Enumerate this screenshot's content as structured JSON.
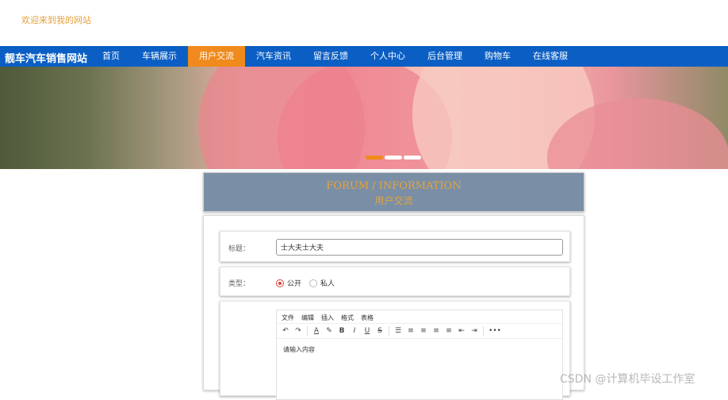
{
  "header": {
    "welcome": "欢迎来到我的网站"
  },
  "nav": {
    "brand": "靓车汽车销售网站",
    "items": [
      {
        "label": "首页"
      },
      {
        "label": "车辆展示"
      },
      {
        "label": "用户交流",
        "active": true
      },
      {
        "label": "汽车资讯"
      },
      {
        "label": "留言反馈"
      },
      {
        "label": "个人中心"
      },
      {
        "label": "后台管理"
      },
      {
        "label": "购物车"
      },
      {
        "label": "在线客服"
      }
    ]
  },
  "banner": {
    "slides": 3,
    "active_slide": 1
  },
  "section": {
    "title_en": "FORUM / INFORMATION",
    "title_cn": "用户交流"
  },
  "form": {
    "title_label": "标题：",
    "title_value": "士大夫士大夫",
    "type_label": "类型：",
    "type_options": [
      "公开",
      "私人"
    ],
    "type_selected": "公开",
    "editor": {
      "menu": [
        "文件",
        "编辑",
        "插入",
        "格式",
        "表格"
      ],
      "toolbar": {
        "undo": "↶",
        "redo": "↷",
        "font_color": "A",
        "highlight": "✎",
        "bold": "B",
        "italic": "I",
        "underline": "U",
        "strike": "S",
        "list": "☰",
        "align_left": "≡",
        "align_center": "≡",
        "align_right": "≡",
        "justify": "≡",
        "indent_out": "⇤",
        "indent_in": "⇥",
        "more": "•••"
      },
      "placeholder": "请输入内容"
    }
  },
  "watermark": "CSDN @计算机毕设工作室",
  "colors": {
    "nav": "#0b5fc4",
    "accent": "#f08a1c",
    "title_panel": "#7a8fa6",
    "gold": "#e6a23c"
  }
}
